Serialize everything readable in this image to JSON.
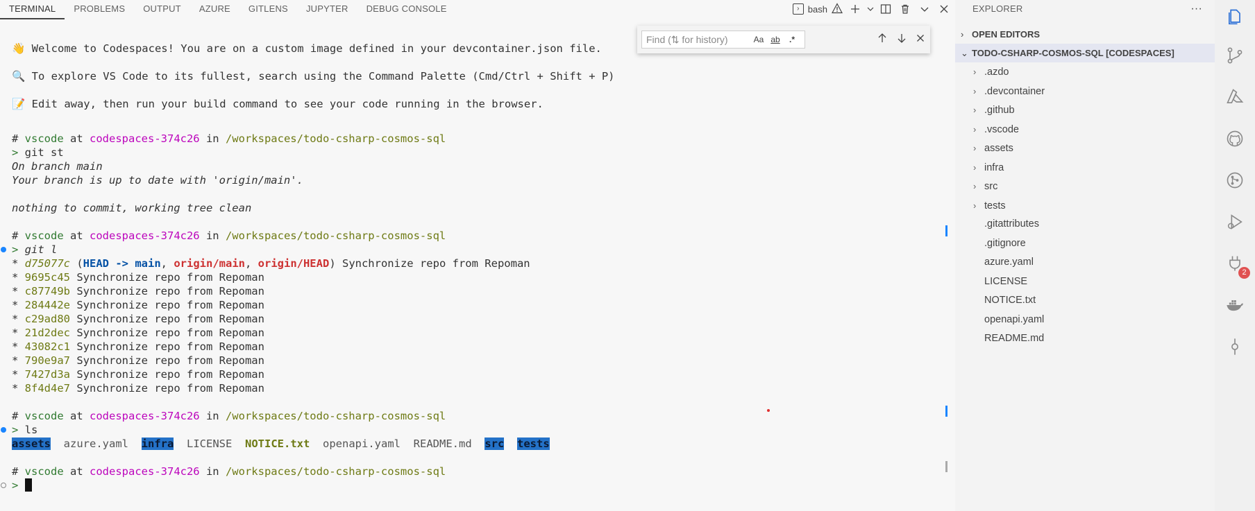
{
  "panel": {
    "tabs": [
      "TERMINAL",
      "PROBLEMS",
      "OUTPUT",
      "AZURE",
      "GITLENS",
      "JUPYTER",
      "DEBUG CONSOLE"
    ],
    "active_tab": "TERMINAL",
    "shell_label": "bash"
  },
  "find": {
    "placeholder": "Find (⇅ for history)",
    "match_case": "Aa",
    "whole_word": "ab",
    "regex": ".*"
  },
  "terminal": {
    "welcome_1": "Welcome to Codespaces! You are on a custom image defined in your devcontainer.json file.",
    "welcome_2": "To explore VS Code to its fullest, search using the Command Palette (Cmd/Ctrl + Shift + P)",
    "welcome_3": "Edit away, then run your build command to see your code running in the browser.",
    "prompt": {
      "hash": "# ",
      "user": "vscode",
      "at": " at ",
      "host": "codespaces-374c26",
      "in": " in ",
      "path": "/workspaces/todo-csharp-cosmos-sql"
    },
    "prompt_symbol": ">",
    "cmd_1": " git st",
    "status_1": "On branch main",
    "status_2": "Your branch is up to date with 'origin/main'.",
    "status_3": "nothing to commit, working tree clean",
    "cmd_2": " git l",
    "head_commit": {
      "hash": "d75077c",
      "head": "HEAD -> main",
      "origin_main": "origin/main",
      "origin_head": "origin/HEAD",
      "message": "Synchronize repo from Repoman"
    },
    "commits": [
      {
        "hash": "9695c45",
        "message": "Synchronize repo from Repoman"
      },
      {
        "hash": "c87749b",
        "message": "Synchronize repo from Repoman"
      },
      {
        "hash": "284442e",
        "message": "Synchronize repo from Repoman"
      },
      {
        "hash": "c29ad80",
        "message": "Synchronize repo from Repoman"
      },
      {
        "hash": "21d2dec",
        "message": "Synchronize repo from Repoman"
      },
      {
        "hash": "43082c1",
        "message": "Synchronize repo from Repoman"
      },
      {
        "hash": "790e9a7",
        "message": "Synchronize repo from Repoman"
      },
      {
        "hash": "7427d3a",
        "message": "Synchronize repo from Repoman"
      },
      {
        "hash": "8f4d4e7",
        "message": "Synchronize repo from Repoman"
      }
    ],
    "cmd_3": " ls",
    "ls": [
      "assets",
      "azure.yaml",
      "infra",
      "LICENSE",
      "NOTICE.txt",
      "openapi.yaml",
      "README.md",
      "src",
      "tests"
    ]
  },
  "explorer": {
    "title": "EXPLORER",
    "open_editors": "OPEN EDITORS",
    "root": "TODO-CSHARP-COSMOS-SQL [CODESPACES]",
    "folders": [
      ".azdo",
      ".devcontainer",
      ".github",
      ".vscode",
      "assets",
      "infra",
      "src",
      "tests"
    ],
    "files": [
      ".gitattributes",
      ".gitignore",
      "azure.yaml",
      "LICENSE",
      "NOTICE.txt",
      "openapi.yaml",
      "README.md"
    ]
  },
  "activity": {
    "items": [
      "files-icon",
      "source-control-icon",
      "azure-icon",
      "github-icon",
      "git-graph-icon",
      "run-debug-icon",
      "extensions-icon",
      "docker-icon",
      "commit-icon"
    ],
    "extensions_badge": "2"
  }
}
